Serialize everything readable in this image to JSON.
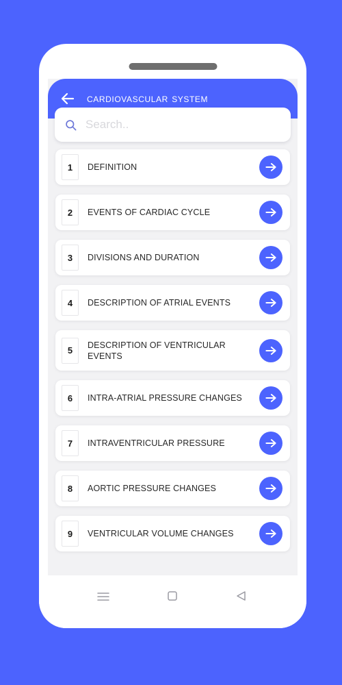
{
  "theme": {
    "background": "#4c63fe",
    "accent": "#4c63fe",
    "screen_background": "#f2f2f4",
    "card_background": "#ffffff"
  },
  "appbar": {
    "back_icon": "arrow-left-icon",
    "title": "Cardiovascular System"
  },
  "search": {
    "icon": "search-icon",
    "placeholder": "Search..",
    "value": ""
  },
  "list": {
    "items": [
      {
        "number": "1",
        "label": "DEFINITION",
        "action_icon": "arrow-right-icon",
        "multiline": false
      },
      {
        "number": "2",
        "label": "EVENTS OF CARDIAC CYCLE",
        "action_icon": "arrow-right-icon",
        "multiline": false
      },
      {
        "number": "3",
        "label": "DIVISIONS AND DURATION",
        "action_icon": "arrow-right-icon",
        "multiline": false
      },
      {
        "number": "4",
        "label": "DESCRIPTION OF ATRIAL EVENTS",
        "action_icon": "arrow-right-icon",
        "multiline": false
      },
      {
        "number": "5",
        "label": "DESCRIPTION OF VENTRICULAR EVENTS",
        "action_icon": "arrow-right-icon",
        "multiline": true
      },
      {
        "number": "6",
        "label": "INTRA-ATRIAL PRESSURE CHANGES",
        "action_icon": "arrow-right-icon",
        "multiline": false
      },
      {
        "number": "7",
        "label": "INTRAVENTRICULAR PRESSURE",
        "action_icon": "arrow-right-icon",
        "multiline": false
      },
      {
        "number": "8",
        "label": "AORTIC PRESSURE CHANGES",
        "action_icon": "arrow-right-icon",
        "multiline": false
      },
      {
        "number": "9",
        "label": "VENTRICULAR VOLUME CHANGES",
        "action_icon": "arrow-right-icon",
        "multiline": false
      }
    ]
  },
  "navbar": {
    "buttons": [
      {
        "name": "recents-button",
        "icon": "menu-icon"
      },
      {
        "name": "home-button",
        "icon": "square-icon"
      },
      {
        "name": "back-button",
        "icon": "triangle-left-icon"
      }
    ]
  }
}
